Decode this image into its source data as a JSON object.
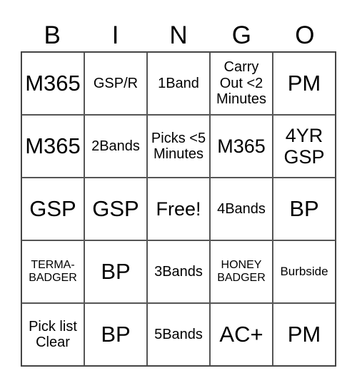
{
  "header": [
    "B",
    "I",
    "N",
    "G",
    "O"
  ],
  "cells": [
    [
      "M365",
      "GSP/R",
      "1Band",
      "Carry Out <2 Minutes",
      "PM"
    ],
    [
      "M365",
      "2Bands",
      "Picks <5 Minutes",
      "M365",
      "4YR GSP"
    ],
    [
      "GSP",
      "GSP",
      "Free!",
      "4Bands",
      "BP"
    ],
    [
      "TERMA- BADGER",
      "BP",
      "3Bands",
      "HONEY BADGER",
      "Burbside"
    ],
    [
      "Pick list Clear",
      "BP",
      "5Bands",
      "AC+",
      "PM"
    ]
  ]
}
